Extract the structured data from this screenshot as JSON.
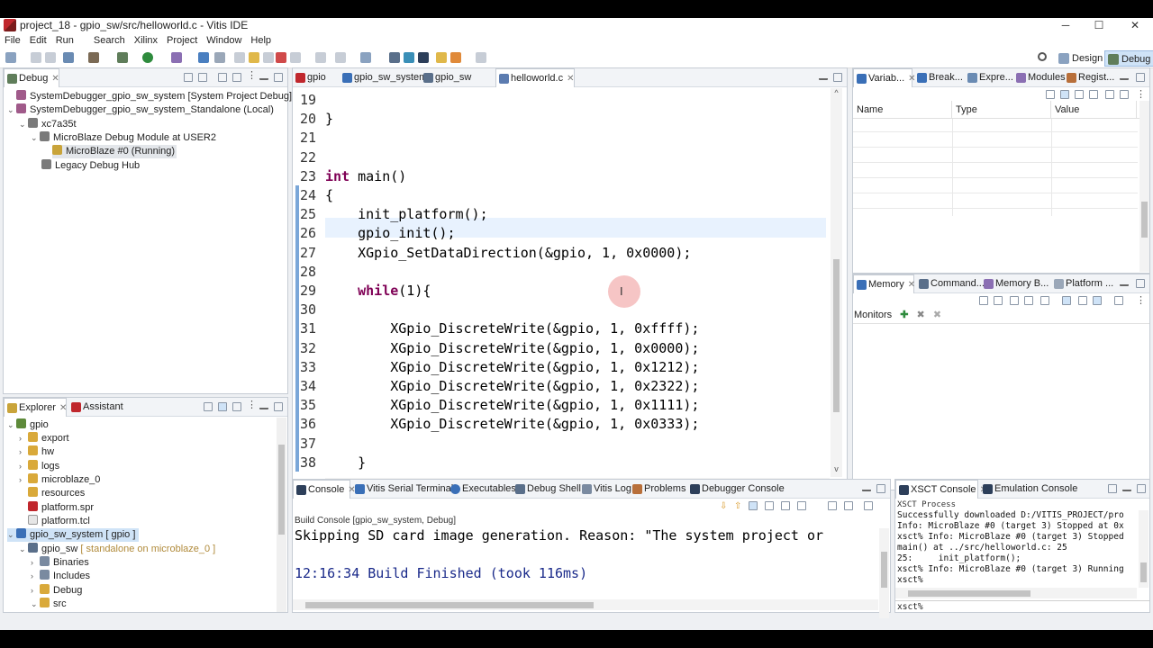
{
  "title": "project_18 - gpio_sw/src/helloworld.c - Vitis IDE",
  "window_buttons": {
    "min": "─",
    "max": "☐",
    "close": "✕"
  },
  "menu": [
    "File",
    "Edit",
    "Run",
    "Search",
    "Xilinx",
    "Project",
    "Window",
    "Help"
  ],
  "perspectives": {
    "design": "Design",
    "debug": "Debug"
  },
  "debug_view": {
    "tab": "Debug",
    "tree": [
      "SystemDebugger_gpio_sw_system [System Project Debug]",
      "SystemDebugger_gpio_sw_system_Standalone (Local)",
      "xc7a35t",
      "MicroBlaze Debug Module at USER2",
      "MicroBlaze #0 (Running)",
      "Legacy Debug Hub"
    ]
  },
  "explorer": {
    "tabs": [
      "Explorer",
      "Assistant"
    ],
    "tree": [
      {
        "label": "gpio",
        "extra": ""
      },
      {
        "label": "export",
        "extra": ""
      },
      {
        "label": "hw",
        "extra": ""
      },
      {
        "label": "logs",
        "extra": ""
      },
      {
        "label": "microblaze_0",
        "extra": ""
      },
      {
        "label": "resources",
        "extra": ""
      },
      {
        "label": "platform.spr",
        "extra": ""
      },
      {
        "label": "platform.tcl",
        "extra": ""
      },
      {
        "label": "gpio_sw_system [ gpio ]",
        "extra": ""
      },
      {
        "label": "gpio_sw",
        "extra": " [ standalone on microblaze_0 ]"
      },
      {
        "label": "Binaries",
        "extra": ""
      },
      {
        "label": "Includes",
        "extra": ""
      },
      {
        "label": "Debug",
        "extra": ""
      },
      {
        "label": "src",
        "extra": ""
      }
    ]
  },
  "editor": {
    "tabs": [
      "gpio",
      "gpio_sw_system",
      "gpio_sw",
      "helloworld.c"
    ],
    "lines": [
      {
        "n": "19",
        "code": ""
      },
      {
        "n": "20",
        "code": "}"
      },
      {
        "n": "21",
        "code": ""
      },
      {
        "n": "22",
        "code": ""
      },
      {
        "n": "23",
        "code": "int main()"
      },
      {
        "n": "24",
        "code": "{"
      },
      {
        "n": "25",
        "code": "    init_platform();"
      },
      {
        "n": "26",
        "code": "    gpio_init();"
      },
      {
        "n": "27",
        "code": "    XGpio_SetDataDirection(&gpio, 1, 0x0000);"
      },
      {
        "n": "28",
        "code": ""
      },
      {
        "n": "29",
        "code": "    while(1){"
      },
      {
        "n": "30",
        "code": ""
      },
      {
        "n": "31",
        "code": "        XGpio_DiscreteWrite(&gpio, 1, 0xffff);"
      },
      {
        "n": "32",
        "code": "        XGpio_DiscreteWrite(&gpio, 1, 0x0000);"
      },
      {
        "n": "33",
        "code": "        XGpio_DiscreteWrite(&gpio, 1, 0x1212);"
      },
      {
        "n": "34",
        "code": "        XGpio_DiscreteWrite(&gpio, 1, 0x2322);"
      },
      {
        "n": "35",
        "code": "        XGpio_DiscreteWrite(&gpio, 1, 0x1111);"
      },
      {
        "n": "36",
        "code": "        XGpio_DiscreteWrite(&gpio, 1, 0x0333);"
      },
      {
        "n": "37",
        "code": ""
      },
      {
        "n": "38",
        "code": "    }"
      }
    ]
  },
  "variables": {
    "tabs": [
      "Variab...",
      "Break...",
      "Expre...",
      "Modules",
      "Regist..."
    ],
    "columns": [
      "Name",
      "Type",
      "Value"
    ]
  },
  "memory": {
    "tabs": [
      "Memory",
      "Command...",
      "Memory B...",
      "Platform ..."
    ],
    "monitors_label": "Monitors"
  },
  "console": {
    "tabs": [
      "Console",
      "Vitis Serial Terminal",
      "Executables",
      "Debug Shell",
      "Vitis Log",
      "Problems",
      "Debugger Console"
    ],
    "subtitle": "Build Console [gpio_sw_system, Debug]",
    "lines": [
      "Skipping SD card image generation. Reason: \"The system project or",
      "",
      "12:16:34 Build Finished (took 116ms)"
    ]
  },
  "xsct": {
    "tabs": [
      "XSCT Console",
      "Emulation Console"
    ],
    "process_label": "XSCT Process",
    "lines": [
      "Successfully downloaded D:/VITIS_PROJECT/pro",
      "Info: MicroBlaze #0 (target 3) Stopped at 0x",
      "xsct% Info: MicroBlaze #0 (target 3) Stopped",
      "main() at ../src/helloworld.c: 25",
      "25:     init_platform();",
      "xsct% Info: MicroBlaze #0 (target 3) Running",
      "xsct%"
    ],
    "prompt": "xsct%"
  },
  "colors": {
    "accent": "#cfe3f7",
    "keyword": "#7f0055",
    "brand": "#c0272d"
  }
}
